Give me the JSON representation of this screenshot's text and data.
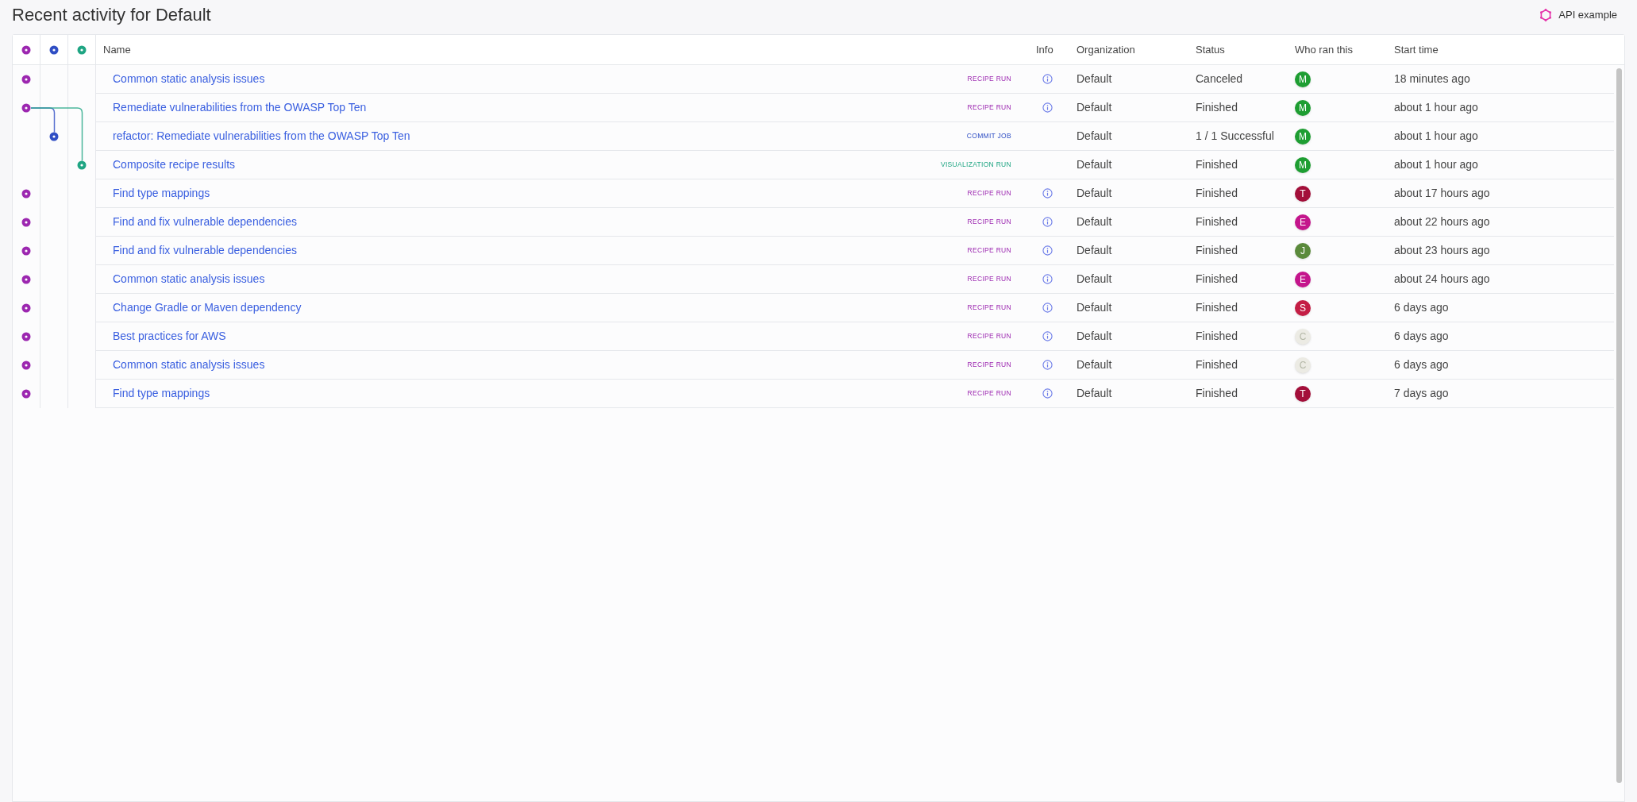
{
  "page": {
    "title": "Recent activity for Default",
    "api_link": "API example"
  },
  "table": {
    "columns": [
      "Name",
      "Info",
      "Organization",
      "Status",
      "Who ran this",
      "Start time"
    ],
    "lanes": [
      {
        "kind": "recipe"
      },
      {
        "kind": "commit"
      },
      {
        "kind": "visualization"
      }
    ],
    "rows": [
      {
        "kind": "recipe",
        "name": "Common static analysis issues",
        "type": "RECIPE RUN",
        "info": true,
        "organization": "Default",
        "status": "Canceled",
        "avatar": {
          "initial": "M",
          "color": "#1e9e32"
        },
        "start_time": "18 minutes ago"
      },
      {
        "kind": "recipe",
        "name": "Remediate vulnerabilities from the OWASP Top Ten",
        "type": "RECIPE RUN",
        "info": true,
        "organization": "Default",
        "status": "Finished",
        "avatar": {
          "initial": "M",
          "color": "#1e9e32"
        },
        "start_time": "about 1 hour ago",
        "children": [
          {
            "kind": "commit",
            "name": "refactor: Remediate vulnerabilities from the OWASP Top Ten",
            "type": "COMMIT JOB",
            "info": false,
            "organization": "Default",
            "status": "1 / 1 Successful",
            "avatar": {
              "initial": "M",
              "color": "#1e9e32"
            },
            "start_time": "about 1 hour ago"
          },
          {
            "kind": "visualization",
            "name": "Composite recipe results",
            "type": "VISUALIZATION RUN",
            "info": false,
            "organization": "Default",
            "status": "Finished",
            "avatar": {
              "initial": "M",
              "color": "#1e9e32"
            },
            "start_time": "about 1 hour ago"
          }
        ]
      },
      {
        "kind": "recipe",
        "name": "Find type mappings",
        "type": "RECIPE RUN",
        "info": true,
        "organization": "Default",
        "status": "Finished",
        "avatar": {
          "initial": "T",
          "color": "#a30f3a"
        },
        "start_time": "about 17 hours ago"
      },
      {
        "kind": "recipe",
        "name": "Find and fix vulnerable dependencies",
        "type": "RECIPE RUN",
        "info": true,
        "organization": "Default",
        "status": "Finished",
        "avatar": {
          "initial": "E",
          "color": "#c4158c"
        },
        "start_time": "about 22 hours ago"
      },
      {
        "kind": "recipe",
        "name": "Find and fix vulnerable dependencies",
        "type": "RECIPE RUN",
        "info": true,
        "organization": "Default",
        "status": "Finished",
        "avatar": {
          "initial": "J",
          "color": "#5b8a3c"
        },
        "start_time": "about 23 hours ago"
      },
      {
        "kind": "recipe",
        "name": "Common static analysis issues",
        "type": "RECIPE RUN",
        "info": true,
        "organization": "Default",
        "status": "Finished",
        "avatar": {
          "initial": "E",
          "color": "#c4158c"
        },
        "start_time": "about 24 hours ago"
      },
      {
        "kind": "recipe",
        "name": "Change Gradle or Maven dependency",
        "type": "RECIPE RUN",
        "info": true,
        "organization": "Default",
        "status": "Finished",
        "avatar": {
          "initial": "S",
          "color": "#c41e45"
        },
        "start_time": "6 days ago"
      },
      {
        "kind": "recipe",
        "name": "Best practices for AWS",
        "type": "RECIPE RUN",
        "info": true,
        "organization": "Default",
        "status": "Finished",
        "avatar": {
          "initial": "C",
          "color": "#ecebe4"
        },
        "start_time": "6 days ago"
      },
      {
        "kind": "recipe",
        "name": "Common static analysis issues",
        "type": "RECIPE RUN",
        "info": true,
        "organization": "Default",
        "status": "Finished",
        "avatar": {
          "initial": "C",
          "color": "#ecebe4"
        },
        "start_time": "6 days ago"
      },
      {
        "kind": "recipe",
        "name": "Find type mappings",
        "type": "RECIPE RUN",
        "info": true,
        "organization": "Default",
        "status": "Finished",
        "avatar": {
          "initial": "T",
          "color": "#a30f3a"
        },
        "start_time": "7 days ago"
      }
    ]
  }
}
